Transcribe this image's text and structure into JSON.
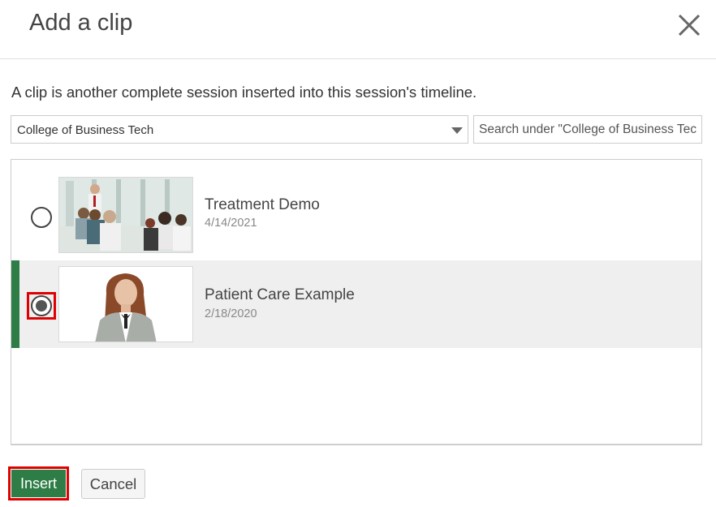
{
  "dialog": {
    "title": "Add a clip",
    "close_icon": "close-icon",
    "description": "A clip is another complete session inserted into this session's timeline."
  },
  "folder_select": {
    "selected": "College of Business Tech",
    "icon": "chevron-down-icon"
  },
  "search": {
    "placeholder": "Search under \"College of Business Tech\"",
    "value": ""
  },
  "clips": [
    {
      "title": "Treatment Demo",
      "date": "4/14/2021",
      "selected": false,
      "thumbnail": "presentation-thumbnail"
    },
    {
      "title": "Patient Care Example",
      "date": "2/18/2020",
      "selected": true,
      "thumbnail": "presenter-thumbnail"
    }
  ],
  "buttons": {
    "insert": "Insert",
    "cancel": "Cancel"
  },
  "colors": {
    "accent": "#2e7d46",
    "highlight": "#e00000",
    "selected_row": "#efefef"
  }
}
